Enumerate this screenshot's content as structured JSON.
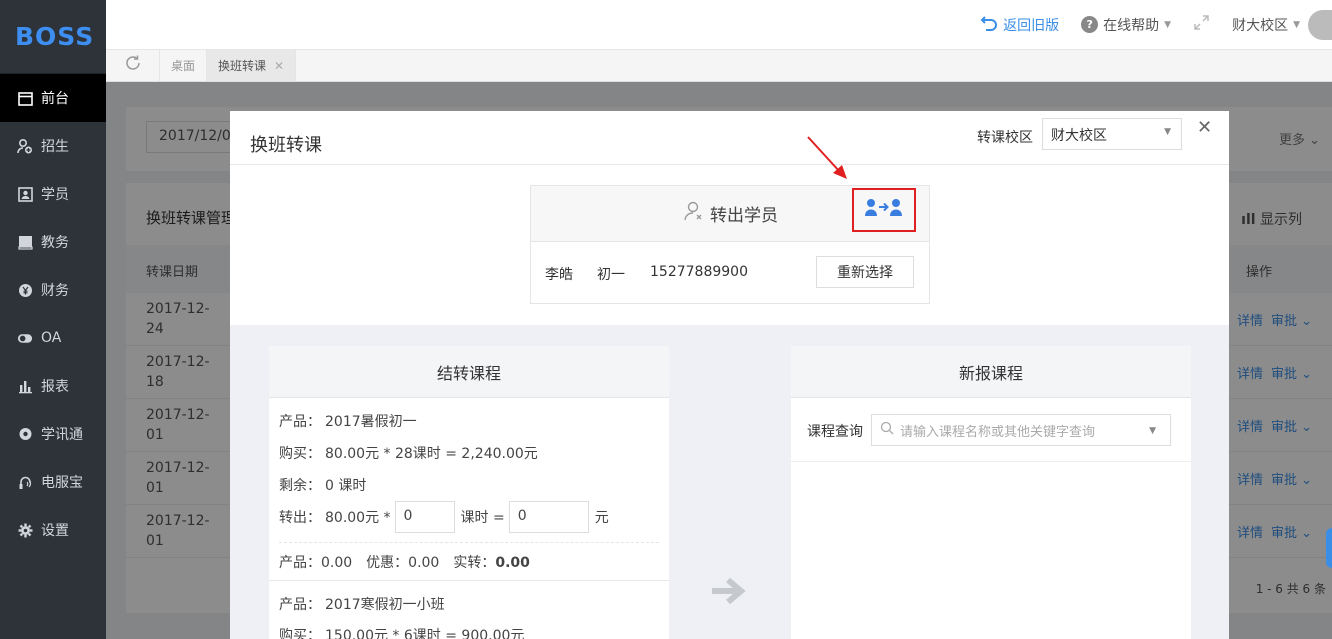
{
  "app": {
    "logo": "BOSS"
  },
  "sidebar": {
    "items": [
      {
        "label": "前台",
        "icon": "calendar-icon",
        "active": true
      },
      {
        "label": "招生",
        "icon": "user-add-icon"
      },
      {
        "label": "学员",
        "icon": "id-card-icon"
      },
      {
        "label": "教务",
        "icon": "book-icon"
      },
      {
        "label": "财务",
        "icon": "yen-icon"
      },
      {
        "label": "OA",
        "icon": "toggle-icon"
      },
      {
        "label": "报表",
        "icon": "bar-chart-icon"
      },
      {
        "label": "学讯通",
        "icon": "location-icon"
      },
      {
        "label": "电服宝",
        "icon": "headset-icon"
      },
      {
        "label": "设置",
        "icon": "gear-icon"
      }
    ]
  },
  "topbar": {
    "old_version": "返回旧版",
    "help": "在线帮助",
    "campus": "财大校区"
  },
  "tabs": [
    {
      "label": "桌面"
    },
    {
      "label": "换班转课",
      "active": true
    }
  ],
  "background": {
    "date_value": "2017/12/0",
    "more": "更多",
    "section_title": "换班转课管理",
    "columns_btn": "显示列",
    "col_date": "转课日期",
    "col_ops": "操作",
    "rows": [
      {
        "date": "2017-12-24"
      },
      {
        "date": "2017-12-18"
      },
      {
        "date": "2017-12-01"
      },
      {
        "date": "2017-12-01"
      },
      {
        "date": "2017-12-01"
      }
    ],
    "op_detail": "详情",
    "op_review": "审批",
    "pager": "1 - 6   共 6 条"
  },
  "modal": {
    "title": "换班转课",
    "campus_label": "转课校区",
    "campus_value": "财大校区",
    "student_header": "转出学员",
    "student": {
      "name": "李皓",
      "grade": "初一",
      "phone": "15277889900"
    },
    "reselect": "重新选择",
    "left_panel": {
      "title": "结转课程",
      "product_label": "产品：",
      "product1": "2017暑假初一",
      "buy_label": "购买：",
      "buy1": "80.00元 * 28课时 = 2,240.00元",
      "remain_label": "剩余：",
      "remain1": "0 课时",
      "out_label": "转出：",
      "out_price": "80.00元 *",
      "out_hours": "0",
      "out_unit_eq": "课时 =",
      "out_amount": "0",
      "out_currency": "元",
      "summary_product": "产品：0.00",
      "summary_discount": "优惠：0.00",
      "summary_actual_label": "实转：",
      "summary_actual": "0.00",
      "product2": "2017寒假初一小班",
      "buy2": "150.00元 * 6课时 = 900.00元"
    },
    "right_panel": {
      "title": "新报课程",
      "query_label": "课程查询",
      "query_placeholder": "请输入课程名称或其他关键字查询"
    }
  },
  "colors": {
    "sidebar_bg": "#2d3339",
    "accent": "#3a8ee6",
    "annotation": "#e02020"
  }
}
